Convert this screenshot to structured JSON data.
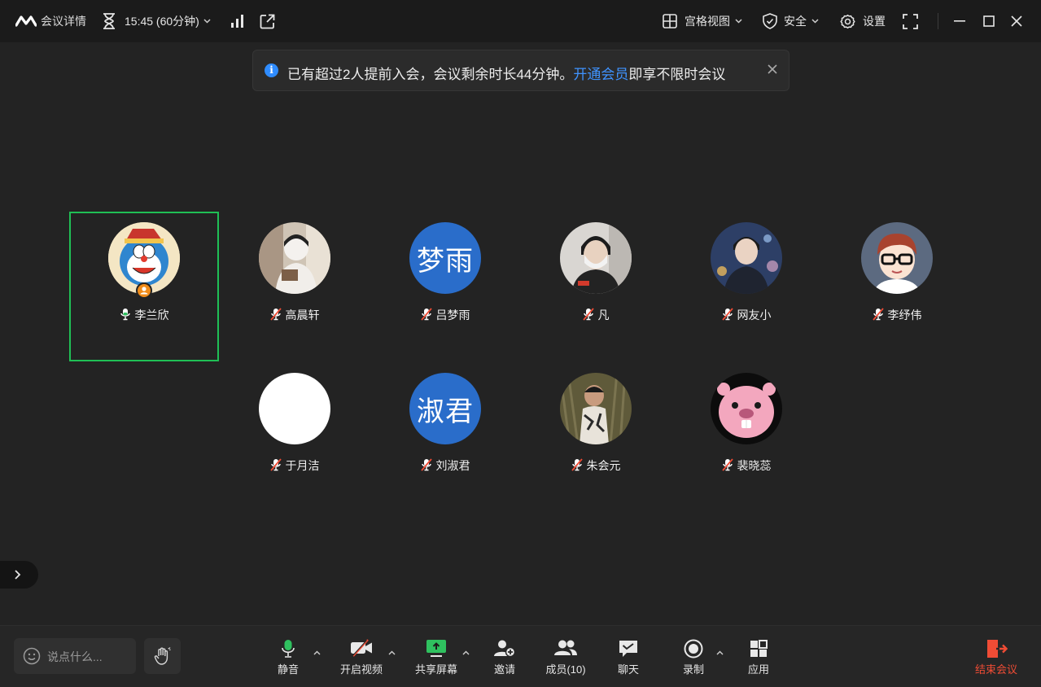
{
  "titlebar": {
    "meeting_details": "会议详情",
    "timer": "15:45 (60分钟)",
    "view_mode": "宫格视图",
    "security": "安全",
    "settings": "设置"
  },
  "notice": {
    "text_before": "已有超过2人提前入会，会议剩余时长44分钟。",
    "link": "开通会员",
    "text_after": "即享不限时会议"
  },
  "participants": [
    {
      "name": "李兰欣",
      "avatar": "doraemon-photo",
      "mic": "active",
      "host": true,
      "speaking": true
    },
    {
      "name": "高晨轩",
      "avatar": "photo",
      "mic": "muted"
    },
    {
      "name": "吕梦雨",
      "avatar_text": "梦雨",
      "mic": "muted"
    },
    {
      "name": "凡",
      "avatar": "photo",
      "mic": "muted"
    },
    {
      "name": "网友小",
      "avatar": "photo",
      "mic": "muted"
    },
    {
      "name": "李纾伟",
      "avatar": "cartoon-boy",
      "mic": "muted"
    },
    {
      "name": "于月洁",
      "avatar": "blank-white",
      "mic": "muted"
    },
    {
      "name": "刘淑君",
      "avatar_text": "淑君",
      "mic": "muted"
    },
    {
      "name": "朱会元",
      "avatar": "photo",
      "mic": "muted"
    },
    {
      "name": "裴晓蕊",
      "avatar": "pink-beaver",
      "mic": "muted"
    }
  ],
  "toolbar": {
    "chat_placeholder": "说点什么...",
    "mute": "静音",
    "video": "开启视频",
    "share": "共享屏幕",
    "invite": "邀请",
    "members": "成员(10)",
    "chat": "聊天",
    "record": "录制",
    "apps": "应用",
    "end": "结束会议"
  },
  "colors": {
    "accent_green": "#1fbf55",
    "link_blue": "#3f93ff",
    "avatar_blue": "#2a6dca",
    "end_red": "#f04c35",
    "host_badge": "#f08c1a"
  }
}
